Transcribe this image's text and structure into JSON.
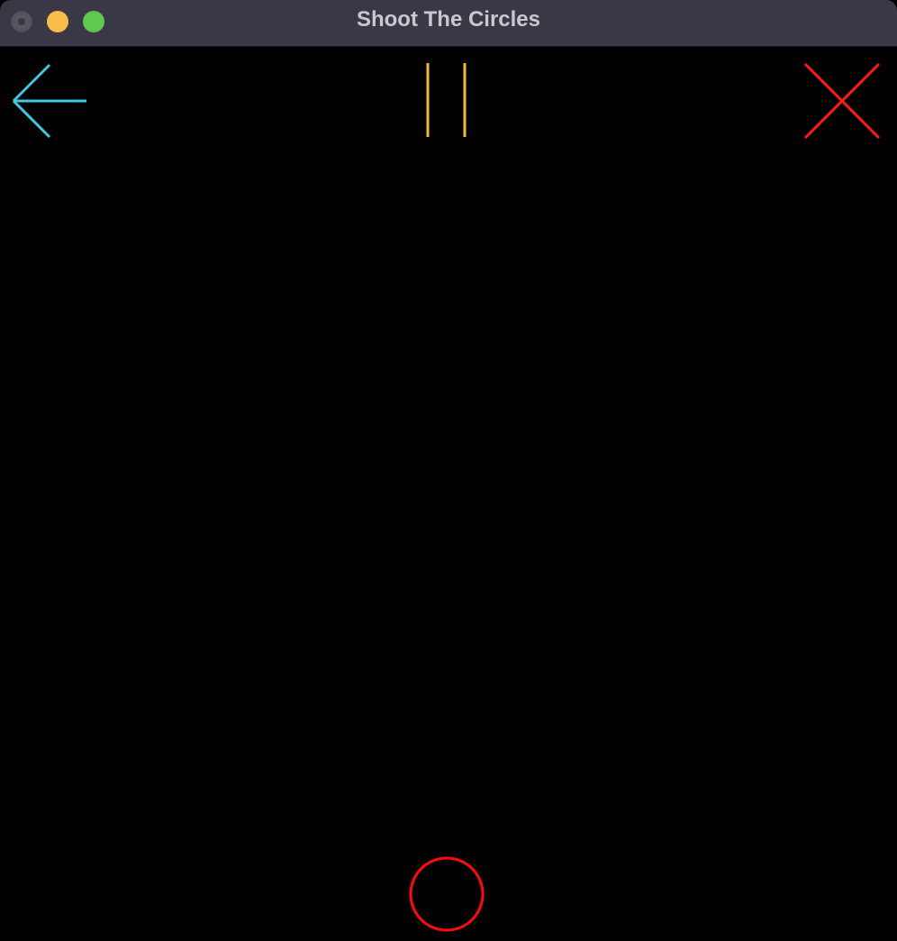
{
  "window": {
    "title": "Shoot The Circles",
    "buttons": [
      "close-window-icon",
      "minimize-window-icon",
      "zoom-window-icon"
    ]
  },
  "hud": {
    "back_icon": "left-arrow-icon",
    "pause_icon": "pause-icon",
    "exit_icon": "x-close-icon"
  },
  "game": {
    "target_icon": "circle-target-icon"
  },
  "colors": {
    "background": "#000000",
    "titlebar": "#3a3844",
    "title_text": "#c9c7cf",
    "back_arrow": "#3ec8e6",
    "pause": "#f5b82a",
    "exit_x": "#ff1a1a",
    "target_circle": "#ff0a0a",
    "traffic_close": "#56555f",
    "traffic_minimize": "#fbbd4a",
    "traffic_zoom": "#5fc84f"
  }
}
